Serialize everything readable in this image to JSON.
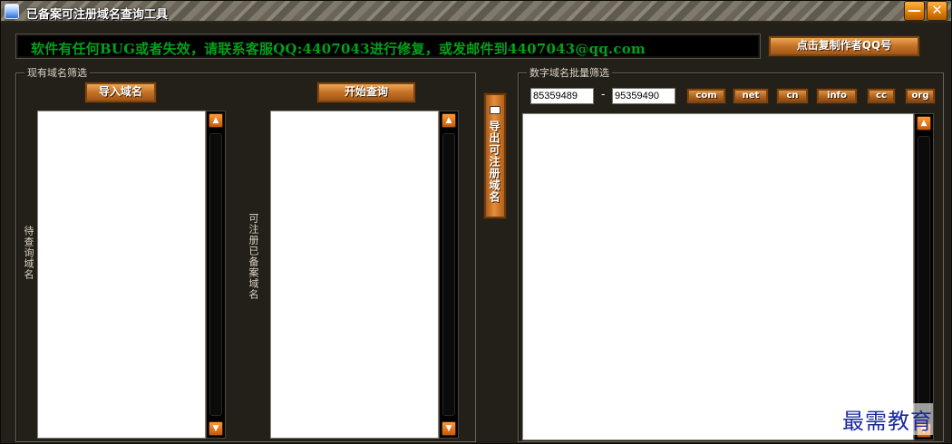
{
  "window": {
    "title": "已备案可注册域名查询工具",
    "minimize_label": "—",
    "close_label": "✕"
  },
  "notice": {
    "text": "软件有任何BUG或者失效，请联系客服QQ:4407043进行修复，或发邮件到4407043@qq.com"
  },
  "header": {
    "contact_button": "点击复制作者QQ号"
  },
  "left_group": {
    "legend": "现有域名筛选",
    "import_button": "导入域名",
    "query_button": "开始查询",
    "pending_label": "待查询域名",
    "registrable_label": "可注册已备案域名",
    "domains_list": [],
    "results_list": []
  },
  "export_button": {
    "label": "导出可注册域名"
  },
  "right_group": {
    "legend": "数字域名批量筛选",
    "range_start": "85359489",
    "range_separator": "-",
    "range_end": "95359490",
    "suffixes": [
      "com",
      "net",
      "cn",
      "info",
      "cc",
      "org"
    ],
    "numeric_list": []
  },
  "watermark": {
    "text": "最需教育"
  },
  "colors": {
    "accent": "#d4802c",
    "notice_text": "#00a11b",
    "background": "#232019",
    "watermark": "#1b2a9a"
  },
  "icons": {
    "app": "app-icon",
    "scroll_up": "scroll-up-icon",
    "scroll_down": "scroll-down-icon",
    "export": "export-icon"
  }
}
